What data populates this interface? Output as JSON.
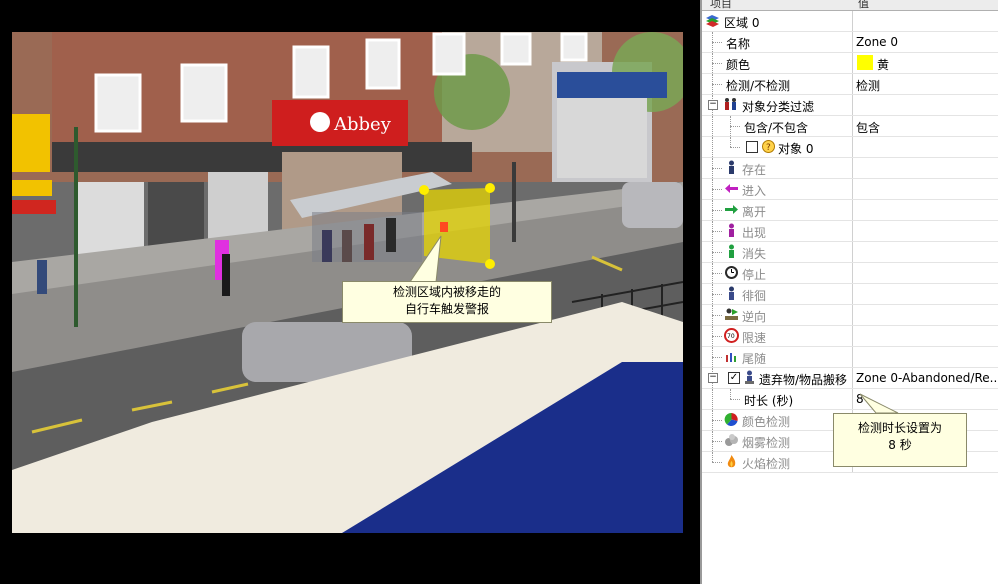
{
  "colors": {
    "zone_fill": "#e6d400",
    "zone_handle": "#ffee00",
    "callout_bg": "#ffffe1",
    "swatch_yellow": "#ffff00"
  },
  "grid": {
    "header": {
      "col1": "项目",
      "col2": "值"
    },
    "rows": {
      "zone": {
        "label": "区域 0",
        "value": "",
        "icon": "zone-layers-icon"
      },
      "name": {
        "label": "名称",
        "value": "Zone 0"
      },
      "color": {
        "label": "颜色",
        "value": "黄"
      },
      "detect": {
        "label": "检测/不检测",
        "value": "检测"
      },
      "classfilter": {
        "label": "对象分类过滤",
        "value": "",
        "icon": "people-filter-icon"
      },
      "include": {
        "label": "包含/不包含",
        "value": "包含"
      },
      "object0": {
        "label": "对象 0",
        "value": "",
        "icon": "question-icon"
      },
      "presence": {
        "label": "存在",
        "icon": "person-presence-icon"
      },
      "enter": {
        "label": "进入",
        "icon": "arrow-enter-icon"
      },
      "exit": {
        "label": "离开",
        "icon": "arrow-exit-icon"
      },
      "appear": {
        "label": "出现",
        "icon": "person-appear-icon"
      },
      "disappear": {
        "label": "消失",
        "icon": "person-disappear-icon"
      },
      "stop": {
        "label": "停止",
        "icon": "clock-stop-icon"
      },
      "loiter": {
        "label": "徘徊",
        "icon": "person-loiter-icon"
      },
      "direction": {
        "label": "逆向",
        "icon": "direction-icon"
      },
      "speed": {
        "label": "限速",
        "icon": "speed-limit-icon",
        "sign": "70"
      },
      "tailgate": {
        "label": "尾随",
        "icon": "tailgating-icon"
      },
      "abandoned": {
        "label": "遗弃物/物品搬移",
        "value": "Zone 0-Abandoned/Re...",
        "icon": "abandoned-object-icon"
      },
      "duration": {
        "label": "时长 (秒)",
        "value": "8"
      },
      "colordetect": {
        "label": "颜色检测",
        "icon": "color-wheel-icon"
      },
      "smoke": {
        "label": "烟雾检测",
        "icon": "smoke-icon"
      },
      "fire": {
        "label": "火焰检测",
        "icon": "fire-icon"
      }
    }
  },
  "video": {
    "shop_sign": "Abbey",
    "callout": {
      "line1": "检测区域内被移走的",
      "line2": "自行车触发警报"
    }
  },
  "callout_duration": {
    "line1": "检测时长设置为",
    "line2": "8 秒"
  }
}
